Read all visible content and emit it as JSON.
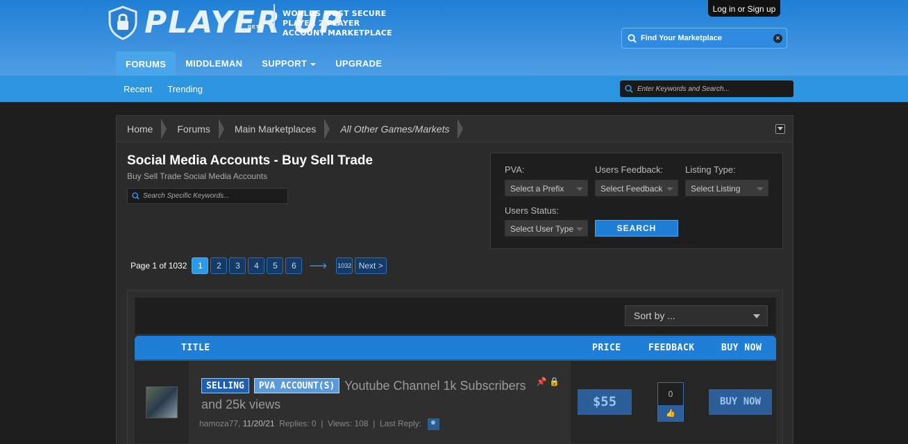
{
  "header": {
    "logo_text": "PLAYER UP",
    "beta_label": "BETA",
    "tagline_line1": "WORLDS MOST SECURE",
    "tagline_line2": "PLAYER 2 PLAYER",
    "tagline_line3": "ACCOUNT MARKETPLACE",
    "login_label": "Log in or Sign up",
    "market_search_placeholder": "Find Your Marketplace"
  },
  "nav": {
    "items": [
      {
        "label": "FORUMS",
        "active": true
      },
      {
        "label": "MIDDLEMAN"
      },
      {
        "label": "SUPPORT"
      },
      {
        "label": "UPGRADE"
      }
    ]
  },
  "subnav": {
    "items": [
      {
        "label": "Recent"
      },
      {
        "label": "Trending"
      }
    ],
    "keyword_search_placeholder": "Enter Keywords and Search..."
  },
  "breadcrumb": [
    "Home",
    "Forums",
    "Main Marketplaces",
    "All Other Games/Markets"
  ],
  "forum": {
    "title": "Social Media Accounts - Buy Sell Trade",
    "description": "Buy Sell Trade Social Media Accounts",
    "search_placeholder": "Search Specific Keywords..."
  },
  "filters": {
    "pva_label": "PVA:",
    "pva_value": "Select a Prefix",
    "feedback_label": "Users Feedback:",
    "feedback_value": "Select Feedback",
    "listing_label": "Listing Type:",
    "listing_value": "Select Listing",
    "status_label": "Users Status:",
    "status_value": "Select User Type",
    "search_button": "SEARCH"
  },
  "pager": {
    "label": "Page 1 of 1032",
    "pages": [
      "1",
      "2",
      "3",
      "4",
      "5",
      "6"
    ],
    "current": "1",
    "last": "1032",
    "next": "Next >"
  },
  "list": {
    "sort_label": "Sort by ...",
    "columns": {
      "title": "TITLE",
      "price": "PRICE",
      "feedback": "FEEDBACK",
      "buy_now": "BUY NOW"
    },
    "threads": [
      {
        "tag_selling": "SELLING",
        "tag_prefix": "PVA ACCOUNT(S)",
        "title": "Youtube Channel 1k Subscribers and 25k views",
        "author": "hamoza77,",
        "date": "11/20/21",
        "replies": "Replies: 0",
        "views": "Views: 108",
        "last_reply": "Last Reply:",
        "price": "$55",
        "feedback_count": "0",
        "buy_label": "BUY NOW"
      }
    ]
  },
  "colors": {
    "accent": "#1f7fd6",
    "header_light": "#4f9ee4",
    "background": "#1e1e1e"
  }
}
